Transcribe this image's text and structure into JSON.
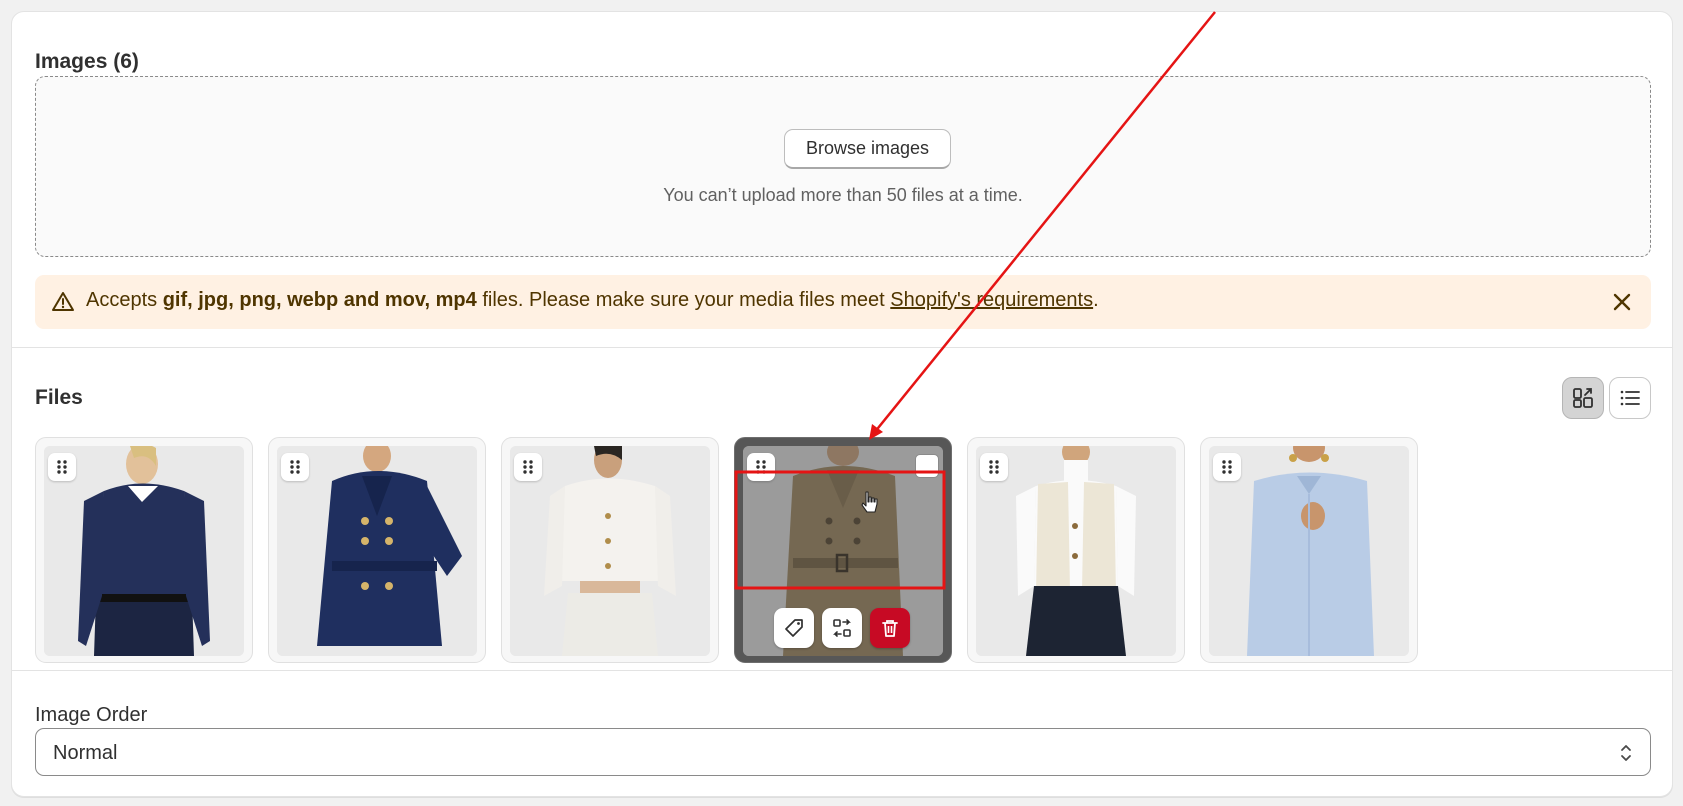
{
  "images_section": {
    "title": "Images (6)",
    "browse_label": "Browse images",
    "upload_hint": "You can’t upload more than 50 files at a time."
  },
  "banner": {
    "prefix": "Accepts ",
    "formats": "gif, jpg, png, webp and mov, mp4",
    "middle": " files. Please make sure your media files meet ",
    "link": "Shopify's requirements",
    "suffix": "."
  },
  "files": {
    "title": "Files",
    "items": [
      {
        "garment": "navy cable-knit sweater",
        "top": "#24305a",
        "bottom": "#1c2542"
      },
      {
        "garment": "navy double-breasted trench",
        "top": "#1f2f5f",
        "bottom": "#1f2f5f"
      },
      {
        "garment": "white cropped jacket",
        "top": "#f4f2ee",
        "bottom": "#ecebe6"
      },
      {
        "garment": "beige belted trench",
        "top": "#a48d65",
        "bottom": "#a48d65"
      },
      {
        "garment": "cream quilted vest",
        "top": "#ece6d6",
        "bottom": "#1d2433"
      },
      {
        "garment": "light blue shirt",
        "top": "#b9cce6",
        "bottom": "#b9cce6"
      }
    ]
  },
  "image_order": {
    "label": "Image Order",
    "value": "Normal"
  },
  "icons": {
    "warning": "warning-icon",
    "close": "close-icon",
    "grid_view": "grid-view-icon",
    "list_view": "list-view-icon",
    "drag": "drag-handle-icon",
    "tag": "tag-icon",
    "replace": "replace-icon",
    "delete": "trash-icon",
    "select": "chevron-up-down-icon"
  },
  "colors": {
    "banner_bg": "#fff1e3",
    "danger": "#c70a24",
    "annotation": "#e51414"
  }
}
